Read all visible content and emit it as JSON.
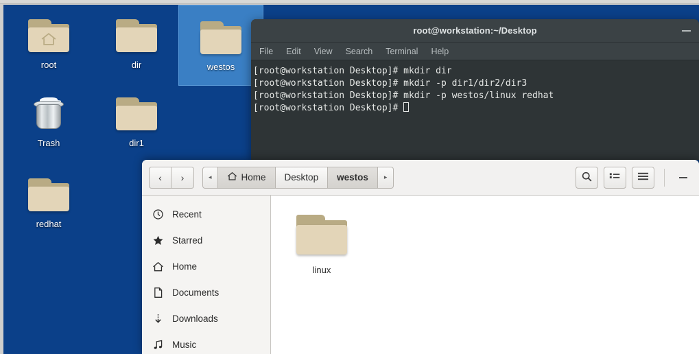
{
  "desktop": {
    "background_color": "#0b4089",
    "selection_color": "#3a7fc4",
    "icons": [
      {
        "label": "root",
        "icon": "folder-home-icon",
        "selected": false
      },
      {
        "label": "dir",
        "icon": "folder-icon",
        "selected": false
      },
      {
        "label": "westos",
        "icon": "folder-icon",
        "selected": true
      },
      {
        "label": "Trash",
        "icon": "trash-icon",
        "selected": false
      },
      {
        "label": "dir1",
        "icon": "folder-icon",
        "selected": false
      },
      {
        "label": "redhat",
        "icon": "folder-icon",
        "selected": false
      }
    ]
  },
  "terminal": {
    "title": "root@workstation:~/Desktop",
    "minimize_label": "–",
    "menu": [
      "File",
      "Edit",
      "View",
      "Search",
      "Terminal",
      "Help"
    ],
    "prompt": "[root@workstation Desktop]# ",
    "lines": [
      {
        "prompt": "[root@workstation Desktop]# ",
        "command": "mkdir dir"
      },
      {
        "prompt": "[root@workstation Desktop]# ",
        "command": "mkdir -p dir1/dir2/dir3"
      },
      {
        "prompt": "[root@workstation Desktop]# ",
        "command": "mkdir -p westos/linux redhat"
      },
      {
        "prompt": "[root@workstation Desktop]# ",
        "command": ""
      }
    ],
    "background_color": "#2e3436",
    "titlebar_color": "#3b4245",
    "text_color": "#e6e8e6"
  },
  "filemanager": {
    "nav": {
      "back": "‹",
      "forward": "›"
    },
    "breadcrumb_prev": "◂",
    "breadcrumb_next": "▸",
    "breadcrumbs": [
      {
        "label": "Home",
        "icon": "home-icon",
        "active": false
      },
      {
        "label": "Desktop",
        "icon": "",
        "active": false
      },
      {
        "label": "westos",
        "icon": "",
        "active": true
      }
    ],
    "toolbar": {
      "search_label": "⌕",
      "view_list_label": "list-view",
      "menu_label": "hamburger-menu",
      "minimize_label": "–"
    },
    "sidebar": [
      {
        "label": "Recent",
        "icon": "clock-icon"
      },
      {
        "label": "Starred",
        "icon": "star-icon"
      },
      {
        "label": "Home",
        "icon": "home-icon"
      },
      {
        "label": "Documents",
        "icon": "document-icon"
      },
      {
        "label": "Downloads",
        "icon": "download-icon"
      },
      {
        "label": "Music",
        "icon": "music-icon"
      }
    ],
    "files": [
      {
        "label": "linux",
        "icon": "folder-icon"
      }
    ]
  }
}
